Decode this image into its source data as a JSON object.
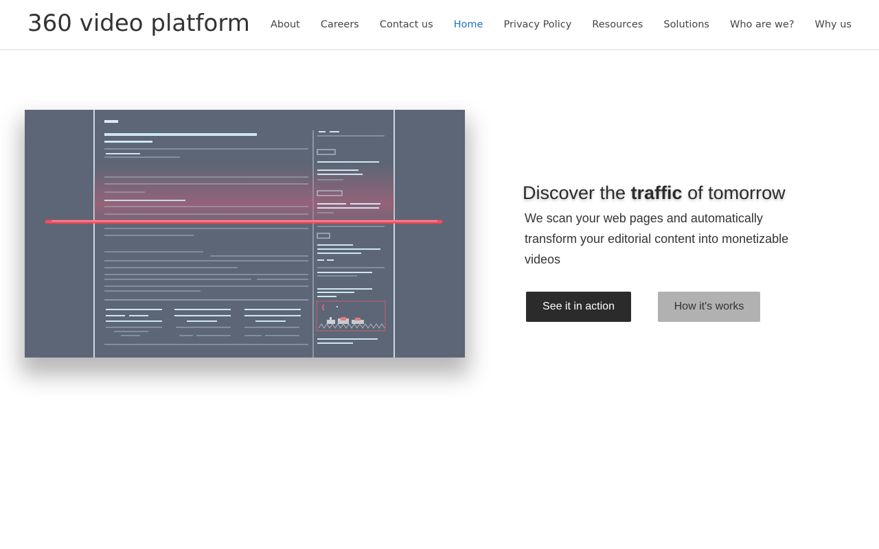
{
  "site": {
    "title": "360 video platform"
  },
  "nav": {
    "items": [
      {
        "label": "About"
      },
      {
        "label": "Careers"
      },
      {
        "label": "Contact us"
      },
      {
        "label": "Home",
        "active": true
      },
      {
        "label": "Privacy Policy"
      },
      {
        "label": "Resources"
      },
      {
        "label": "Solutions"
      },
      {
        "label": "Who are we?"
      },
      {
        "label": "Why us"
      }
    ]
  },
  "hero": {
    "heading_pre": "Discover the ",
    "heading_bold": "traffic",
    "heading_post": " of tomorrow",
    "description": "We scan your web pages and automatically transform your editorial content into monetizable videos",
    "primary_button": "See it in action",
    "secondary_button": "How it's works",
    "image": "webpage-scan-illustration"
  },
  "colors": {
    "accent": "#1e73be",
    "text": "#333333",
    "primary_button_bg": "#2b2b2b",
    "secondary_button_bg": "#b1b1b1",
    "illustration_bg": "#5d6676",
    "scan_line": "#ff4a5a"
  }
}
